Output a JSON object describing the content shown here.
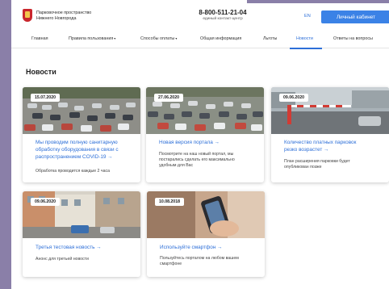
{
  "header": {
    "brand_line1": "Парковочное пространство",
    "brand_line2": "Нижнего Новгорода",
    "phone": "8-800-511-21-04",
    "phone_caption": "единый контакт-центр",
    "lang": "EN",
    "cabinet_button": "Личный кабинет",
    "colors": {
      "accent": "#3b82e6",
      "link": "#2d6fd8",
      "logo_red": "#c9262c"
    }
  },
  "nav": {
    "items": [
      {
        "label": "Главная",
        "dropdown": false,
        "active": false
      },
      {
        "label": "Правила пользования",
        "dropdown": true,
        "active": false
      },
      {
        "label": "Способы оплаты",
        "dropdown": true,
        "active": false
      },
      {
        "label": "Общая информация",
        "dropdown": false,
        "active": false
      },
      {
        "label": "Льготы",
        "dropdown": false,
        "active": false
      },
      {
        "label": "Новости",
        "dropdown": false,
        "active": true
      },
      {
        "label": "Ответы на вопросы",
        "dropdown": false,
        "active": false
      }
    ],
    "caret_icon": "chevron-down-icon"
  },
  "page": {
    "title": "Новости"
  },
  "news": [
    {
      "date": "15.07.2020",
      "title_lines": [
        "Мы проводим полную санитарную",
        "обработку оборудования в связи с",
        "распространением COVID-19"
      ],
      "desc_lines": [
        "Обработка проводится каждые 2 часа"
      ],
      "image": "parking-lot-photo"
    },
    {
      "date": "27.06.2020",
      "title_lines": [
        "Новая версия портала"
      ],
      "desc_lines": [
        "Посмотрите на наш новый портал, мы",
        "постарались сделать его максимально",
        "удобным для Вас"
      ],
      "image": "parking-lot-photo"
    },
    {
      "date": "09.06.2020",
      "title_lines": [
        "Количество платных парковок",
        "резко возрастет"
      ],
      "desc_lines": [
        "План расширения парковки будет",
        "опубликован позже"
      ],
      "image": "parking-barrier-photo"
    },
    {
      "date": "09.06.2020",
      "title_lines": [
        "Третья тестовая новость"
      ],
      "desc_lines": [
        "Анонс для третьей новости"
      ],
      "image": "city-street-photo"
    },
    {
      "date": "10.08.2018",
      "title_lines": [
        "Используйте смартфон"
      ],
      "desc_lines": [
        "Пользуйтесь порталом на любом вашем",
        "смартфоне"
      ],
      "image": "smartphone-hand-photo"
    }
  ],
  "arrow_glyph": "→"
}
